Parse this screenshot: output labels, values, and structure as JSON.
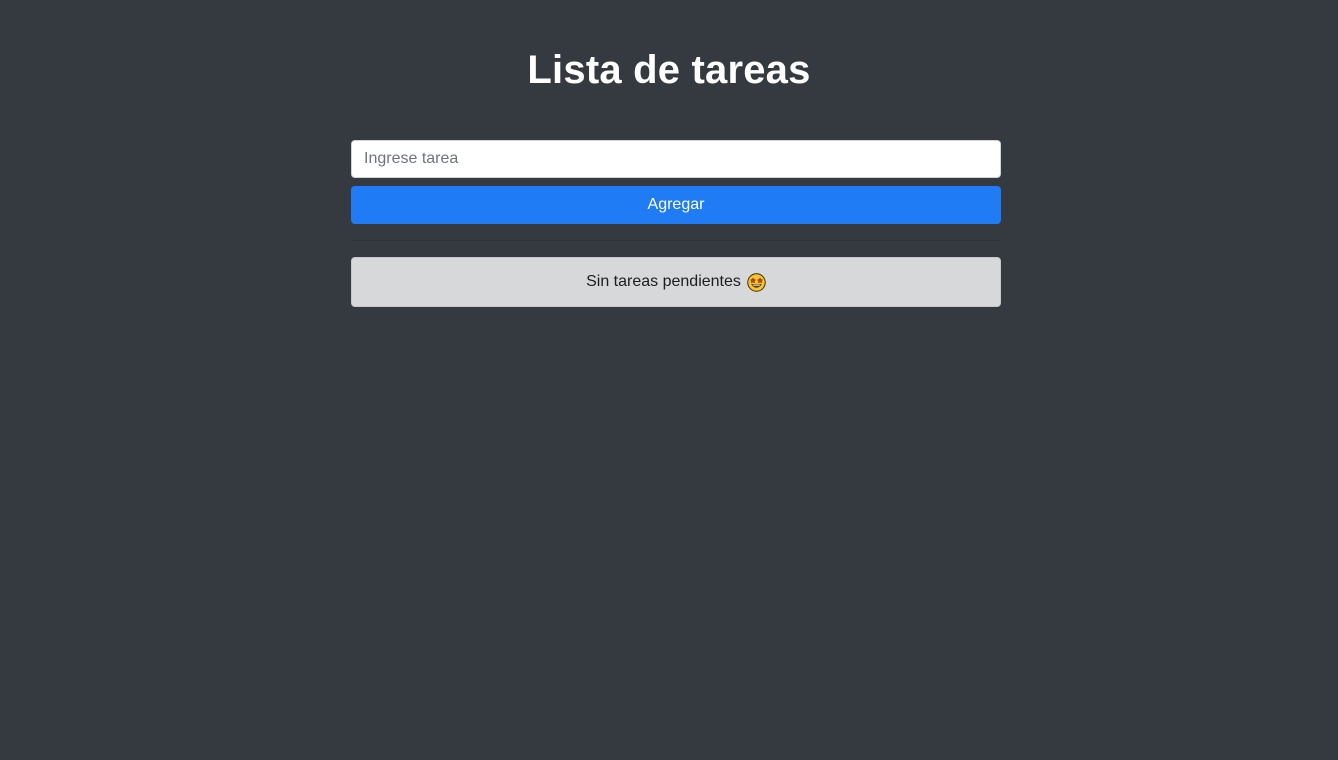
{
  "header": {
    "title": "Lista de tareas"
  },
  "form": {
    "input_placeholder": "Ingrese tarea",
    "input_value": "",
    "add_label": "Agregar"
  },
  "tasks": {
    "empty_message": "Sin tareas pendientes",
    "empty_icon": "star-struck-face-icon"
  },
  "colors": {
    "background": "#343a40",
    "primary": "#1f7cf4",
    "alert_background": "#d6d8d9"
  }
}
